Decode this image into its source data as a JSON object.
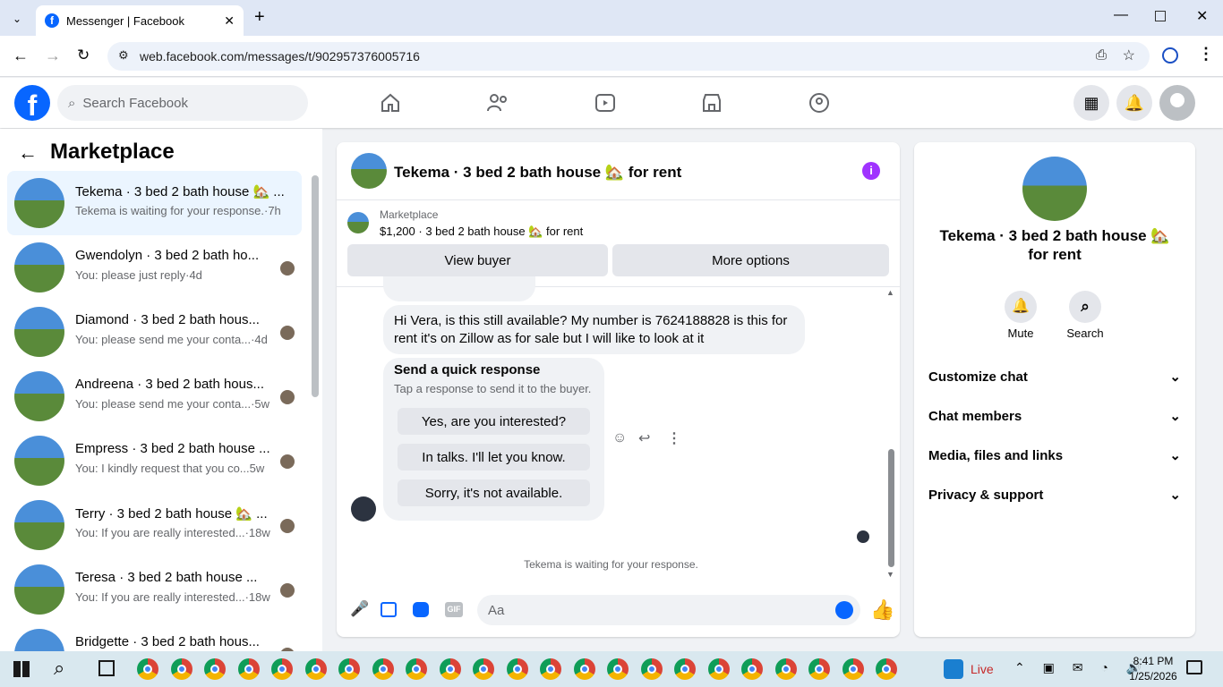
{
  "browser": {
    "tab_title": "Messenger | Facebook",
    "url": "web.facebook.com/messages/t/902957376005716"
  },
  "fb": {
    "search_placeholder": "Search Facebook"
  },
  "left": {
    "title": "Marketplace",
    "conversations": [
      {
        "name": "Tekema · 3 bed 2 bath house 🏡 ...",
        "snippet": "Tekema is waiting for your response.",
        "time": "·7h",
        "active": true
      },
      {
        "name": "Gwendolyn · 3 bed 2 bath ho...",
        "snippet": "You: please just reply",
        "time": "·4d"
      },
      {
        "name": "Diamond · 3 bed 2 bath hous...",
        "snippet": "You: please send me your conta...",
        "time": "·4d"
      },
      {
        "name": "Andreena · 3 bed 2 bath hous...",
        "snippet": "You: please send me your conta...",
        "time": "·5w"
      },
      {
        "name": "Empress · 3 bed 2 bath house ...",
        "snippet": "You: I kindly request that you co...",
        "time": "5w"
      },
      {
        "name": "Terry · 3 bed 2 bath house 🏡 ...",
        "snippet": "You: If you are really interested...",
        "time": "·18w"
      },
      {
        "name": "Teresa · 3 bed 2 bath house ...",
        "snippet": "You: If you are really interested...",
        "time": "·18w"
      },
      {
        "name": "Bridgette · 3 bed 2 bath hous...",
        "snippet": "",
        "time": ""
      }
    ]
  },
  "chat": {
    "title": "Tekema · 3 bed 2 bath house 🏡 for rent",
    "listing_label": "Marketplace",
    "listing_detail": "$1,200 · 3 bed 2 bath house 🏡 for rent",
    "view_buyer": "View buyer",
    "more_options": "More options",
    "message": "Hi Vera, is this still available? My number is 7624188828 is this for rent it's on Zillow as for sale but I will like to look at it",
    "quick_title": "Send a quick response",
    "quick_sub": "Tap a response to send it to the buyer.",
    "quick_options": [
      "Yes, are you interested?",
      "In talks. I'll let you know.",
      "Sorry, it's not available."
    ],
    "status": "Tekema is waiting for your response.",
    "composer_placeholder": "Aa"
  },
  "right": {
    "name": "Tekema · 3 bed 2 bath house 🏡 for rent",
    "mute": "Mute",
    "search": "Search",
    "sections": [
      "Customize chat",
      "Chat members",
      "Media, files and links",
      "Privacy & support"
    ]
  },
  "taskbar": {
    "weather": "Live",
    "time": "8:41 PM",
    "date": "1/25/2026"
  },
  "colors": {
    "fb_blue": "#0866ff",
    "messenger_purple": "#a033ff",
    "active_row": "#ebf5ff"
  }
}
